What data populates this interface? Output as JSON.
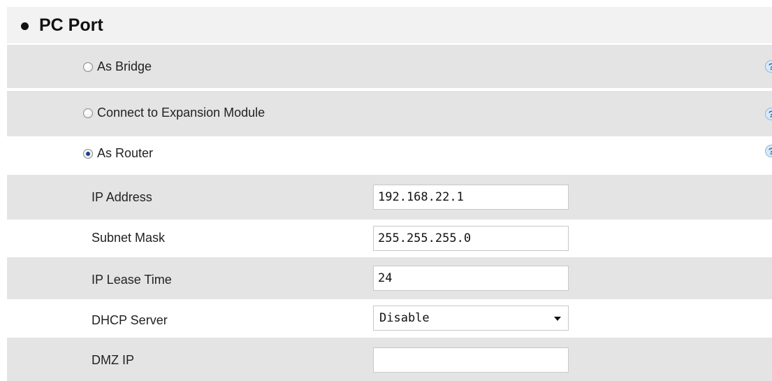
{
  "section": {
    "title": "PC Port"
  },
  "port_mode": {
    "options": [
      {
        "label": "As Bridge",
        "selected": false
      },
      {
        "label": "Connect to Expansion Module",
        "selected": false
      },
      {
        "label": "As Router",
        "selected": true
      }
    ],
    "help_icon": "question-help-icon",
    "help_glyph": "?"
  },
  "router_settings": {
    "ip_address": {
      "label": "IP Address",
      "value": "192.168.22.1"
    },
    "subnet_mask": {
      "label": "Subnet Mask",
      "value": "255.255.255.0"
    },
    "ip_lease_time": {
      "label": "IP Lease Time",
      "value": "24"
    },
    "dhcp_server": {
      "label": "DHCP Server",
      "value": "Disable"
    },
    "dmz_ip": {
      "label": "DMZ IP",
      "value": ""
    }
  },
  "colors": {
    "row_gray": "#e4e4e4",
    "header_gray": "#f2f2f2",
    "radio_selected": "#1d3d8f",
    "help_icon": "#2b6fb3"
  }
}
